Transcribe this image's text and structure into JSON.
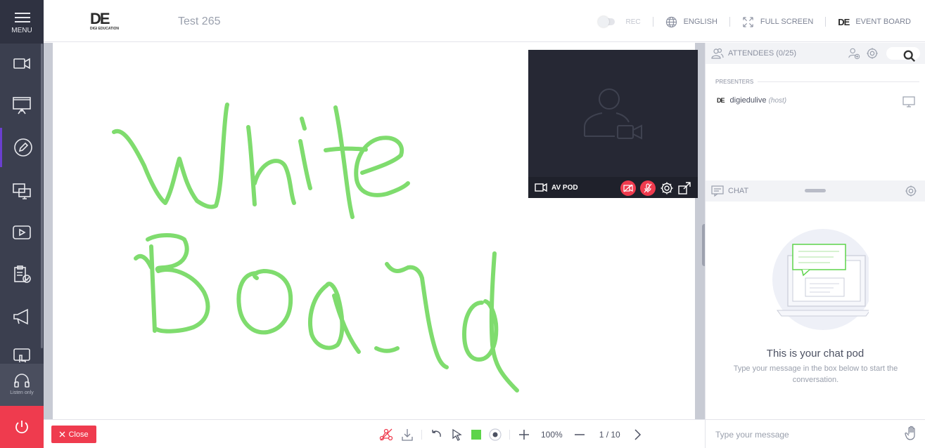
{
  "sidebar": {
    "menu_label": "MENU",
    "items": [
      {
        "icon": "video-camera-icon"
      },
      {
        "icon": "presentation-board-icon"
      },
      {
        "icon": "pencil-icon"
      },
      {
        "icon": "screen-share-icon"
      },
      {
        "icon": "play-video-icon"
      },
      {
        "icon": "clipboard-check-icon"
      },
      {
        "icon": "megaphone-icon"
      },
      {
        "icon": "hand-pointer-icon"
      }
    ],
    "listen_only_label": "Listen only"
  },
  "header": {
    "logo_text": "DE",
    "logo_sub": "DIGI EDUCATION",
    "title": "Test 265",
    "rec_label": "REC",
    "language_label": "ENGLISH",
    "fullscreen_label": "FULL SCREEN",
    "event_board_label": "EVENT BOARD"
  },
  "av_pod": {
    "label": "AV POD"
  },
  "attendees": {
    "label": "ATTENDEES (0/25)",
    "presenters_label": "PRESENTERS",
    "presenter_name": "digiedulive",
    "presenter_role": "(host)"
  },
  "chat": {
    "label": "CHAT",
    "empty_title": "This is your chat pod",
    "empty_subtitle": "Type your message in the box below to start the conversation.",
    "input_placeholder": "Type your message"
  },
  "whiteboard": {
    "ink_color": "#7fdc6e",
    "close_label": "Close",
    "zoom": "100%",
    "page_indicator": "1 / 10",
    "pen_color": "#5dd44a"
  },
  "colors": {
    "sidebar": "#3b3f4f",
    "accent_red": "#ef3b4e",
    "accent_purple": "#6a3fd0"
  }
}
